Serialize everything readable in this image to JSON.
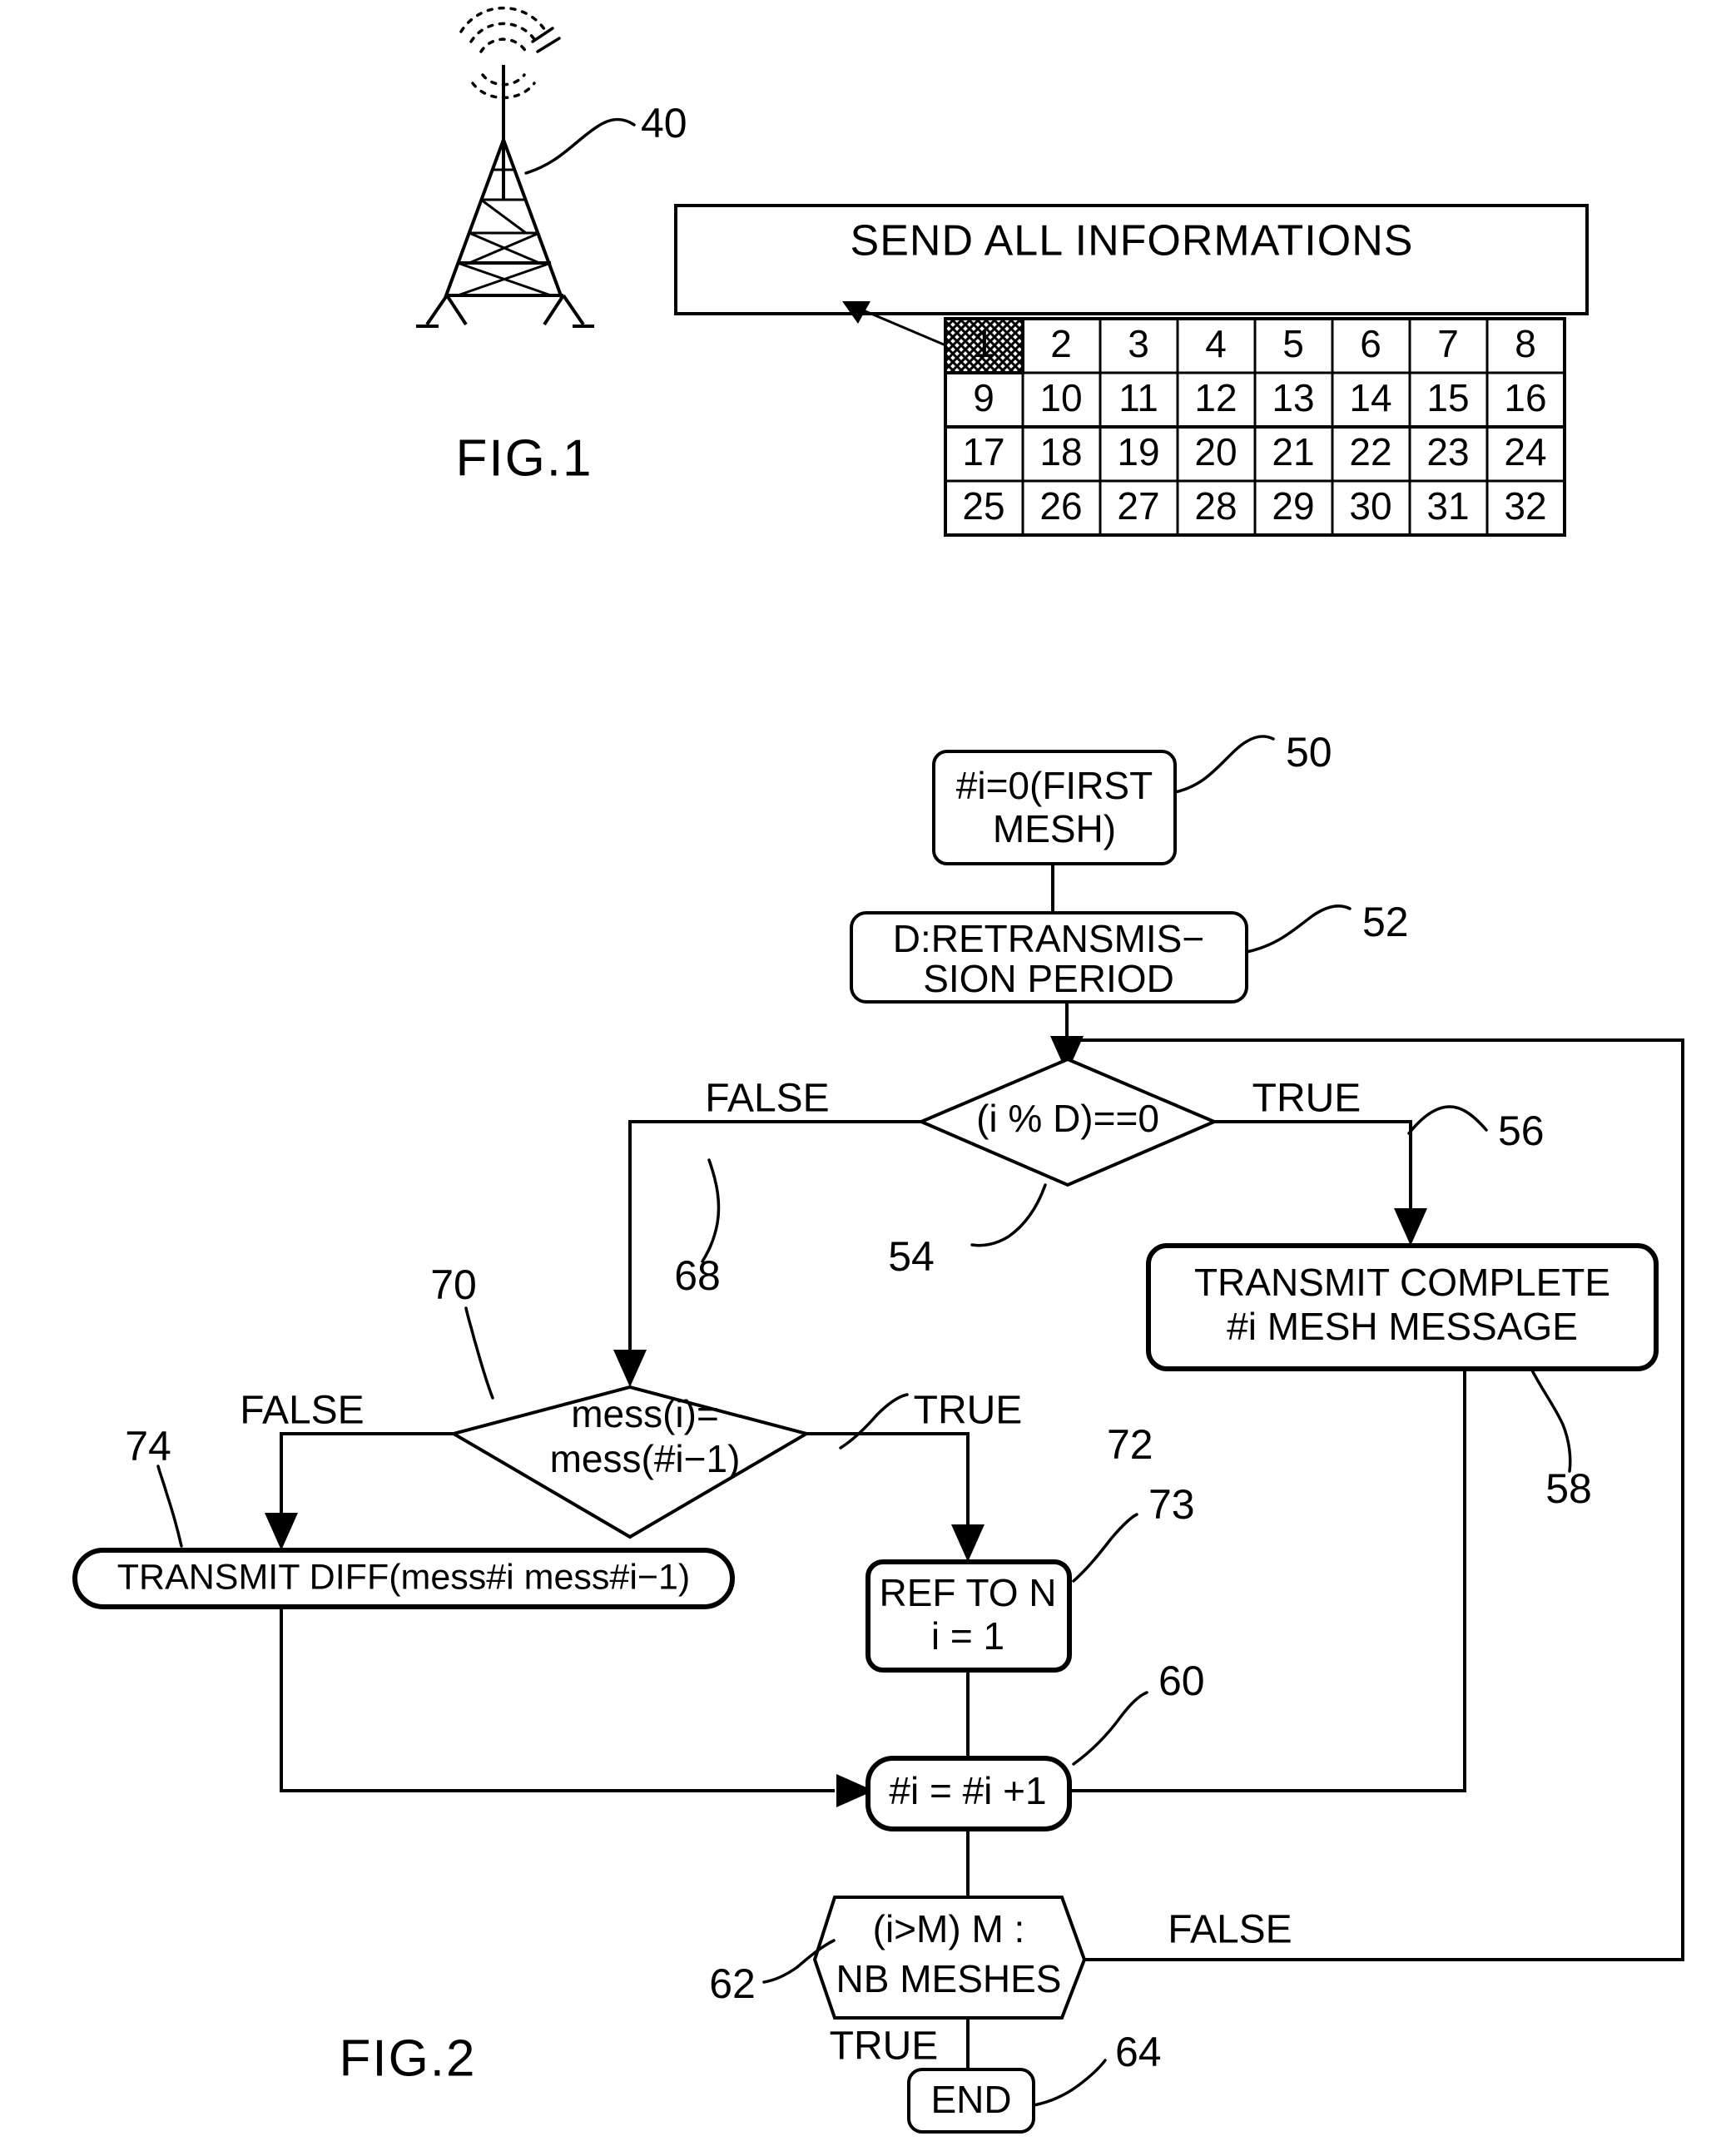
{
  "figures": [
    {
      "id": "fig1",
      "caption": "FIG.1",
      "antenna_ref": "40",
      "send_box_label": "SEND ALL INFORMATIONS",
      "grid": {
        "columns": 8,
        "rows": 4,
        "highlighted_cell": "1",
        "cells": [
          "1",
          "2",
          "3",
          "4",
          "5",
          "6",
          "7",
          "8",
          "9",
          "10",
          "11",
          "12",
          "13",
          "14",
          "15",
          "16",
          "17",
          "18",
          "19",
          "20",
          "21",
          "22",
          "23",
          "24",
          "25",
          "26",
          "27",
          "28",
          "29",
          "30",
          "31",
          "32"
        ]
      }
    },
    {
      "id": "fig2",
      "caption": "FIG.2",
      "nodes": {
        "start": {
          "ref": "50",
          "line1": "#i=0(FIRST",
          "line2": "MESH)"
        },
        "period": {
          "ref": "52",
          "line1": "D:RETRANSMIS−",
          "line2": "SION PERIOD"
        },
        "mod_decision": {
          "ref": "54",
          "text": "(i % D)==0"
        },
        "mod_true_branch": {
          "ref": "56",
          "label": "TRUE"
        },
        "mod_false_branch": {
          "ref": "68",
          "label": "FALSE"
        },
        "transmit_complete": {
          "ref": "58",
          "line1": "TRANSMIT COMPLETE",
          "line2": "#i MESH MESSAGE"
        },
        "mess_decision": {
          "ref": "70",
          "line1": "mess(i)=",
          "line2": "mess(#i−1)"
        },
        "mess_true_branch": {
          "ref": "72",
          "label": "TRUE"
        },
        "mess_false_branch": {
          "ref": "74",
          "label": "FALSE"
        },
        "transmit_diff": {
          "text": "TRANSMIT DIFF(mess#i mess#i−1)"
        },
        "ref_to_n": {
          "ref": "73",
          "line1": "REF TO N",
          "line2": "i = 1"
        },
        "increment": {
          "ref": "60",
          "text": "#i = #i +1"
        },
        "limit_decision": {
          "ref": "62",
          "line1": "(i>M) M :",
          "line2": "NB MESHES",
          "true_label": "TRUE",
          "false_label": "FALSE"
        },
        "end": {
          "ref": "64",
          "text": "END"
        }
      }
    }
  ]
}
